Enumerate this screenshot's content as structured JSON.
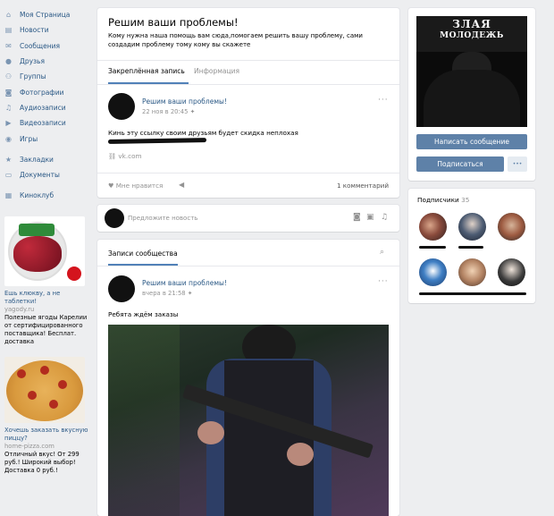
{
  "sidebar": {
    "items": [
      {
        "label": "Моя Страница",
        "icon": "home-icon"
      },
      {
        "label": "Новости",
        "icon": "news-icon"
      },
      {
        "label": "Сообщения",
        "icon": "messages-icon"
      },
      {
        "label": "Друзья",
        "icon": "friends-icon"
      },
      {
        "label": "Группы",
        "icon": "groups-icon"
      },
      {
        "label": "Фотографии",
        "icon": "camera-icon"
      },
      {
        "label": "Аудиозаписи",
        "icon": "music-icon"
      },
      {
        "label": "Видеозаписи",
        "icon": "video-icon"
      },
      {
        "label": "Игры",
        "icon": "gamepad-icon"
      },
      {
        "label": "Закладки",
        "icon": "star-icon"
      },
      {
        "label": "Документы",
        "icon": "document-icon"
      },
      {
        "label": "Киноклуб",
        "icon": "apps-icon"
      }
    ]
  },
  "ads": [
    {
      "title": "Ешь клюкву, а не таблетки!",
      "domain": "yagody.ru",
      "text": "Полезные ягоды Карелии от сертифицированного поставщика! Бесплат. доставка"
    },
    {
      "title": "Хочешь заказать вкусную пиццу?",
      "domain": "home-pizza.com",
      "text": "Отличный вкус! От 299 руб.! Широкий выбор! Доставка 0 руб.!"
    }
  ],
  "group": {
    "name": "Решим ваши проблемы!",
    "status": "Кому нужна наша помощь вам сюда,помогаем решить вашу проблему, сами создадим проблему тому кому вы скажете",
    "tabs": [
      "Закреплённая запись",
      "Информация"
    ]
  },
  "pinned_post": {
    "author": "Решим ваши проблемы!",
    "time": "22 ноя в 20:45",
    "text": "Кинь эту ссылку своим друзьям будет скидка неплохая",
    "link": "vk.com",
    "like_label": "Мне нравится",
    "comments": "1 комментарий"
  },
  "composer": {
    "placeholder": "Предложите новость"
  },
  "wall": {
    "title": "Записи сообщества",
    "post": {
      "author": "Решим ваши проблемы!",
      "time": "вчера в 21:58",
      "text": "Ребята ждём заказы"
    }
  },
  "right": {
    "cover_text_1": "ЗЛАЯ",
    "cover_text_2": "МОЛОДЕЖЬ",
    "message_button": "Написать сообщение",
    "subscribe_button": "Подписаться",
    "more_button": "•••",
    "subscribers_label": "Подписчики",
    "subscribers_count": "35"
  },
  "colors": {
    "link": "#2a5885",
    "button": "#5e81a8",
    "background": "#edeef0"
  }
}
